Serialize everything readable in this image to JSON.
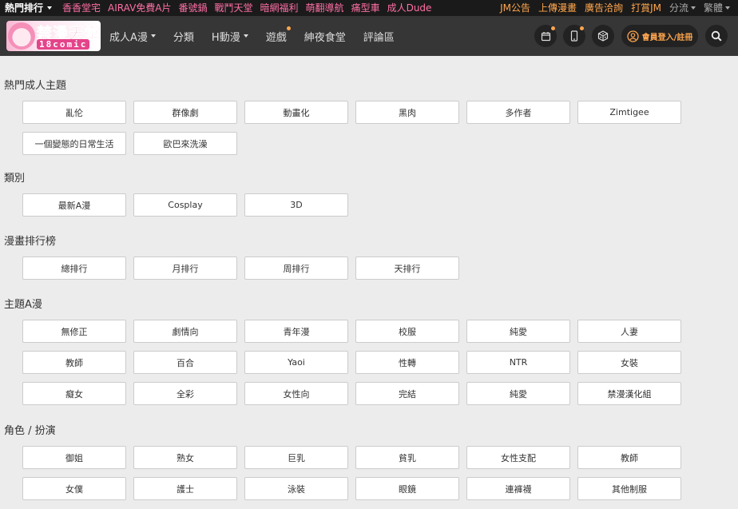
{
  "topbar": {
    "rank_label": "熱門排行",
    "links": [
      "香香堂宅",
      "AIRAV免費A片",
      "番號鍋",
      "戰鬥天堂",
      "暗網福利",
      "萌翻導航",
      "痛型車",
      "成人Dude"
    ],
    "right_orange": [
      "JM公告",
      "上傳漫畫",
      "廣告洽詢",
      "打賞JM"
    ],
    "split_label": "分流",
    "lang_label": "繁體"
  },
  "header": {
    "logo_title": "禁漫天堂",
    "logo_sub": "18comic",
    "nav": [
      {
        "label": "成人A漫",
        "dropdown": true
      },
      {
        "label": "分類",
        "dropdown": false
      },
      {
        "label": "H動漫",
        "dropdown": true
      },
      {
        "label": "遊戲",
        "dropdown": false
      },
      {
        "label": "紳夜食堂",
        "dropdown": false
      },
      {
        "label": "評論區",
        "dropdown": false
      }
    ],
    "login_label": "會員登入/註冊"
  },
  "sections": [
    {
      "title": "熱門成人主題",
      "tags": [
        "亂伦",
        "群像劇",
        "動畫化",
        "黑肉",
        "多作者",
        "Zimtigee",
        "一個變態的日常生活",
        "歐巴來洗澡"
      ]
    },
    {
      "title": "類別",
      "tags": [
        "最新A漫",
        "Cosplay",
        "3D"
      ]
    },
    {
      "title": "漫畫排行榜",
      "tags": [
        "總排行",
        "月排行",
        "周排行",
        "天排行"
      ]
    },
    {
      "title": "主題A漫",
      "tags": [
        "無修正",
        "劇情向",
        "青年漫",
        "校服",
        "純愛",
        "人妻",
        "教師",
        "百合",
        "Yaoi",
        "性轉",
        "NTR",
        "女裝",
        "癡女",
        "全彩",
        "女性向",
        "完結",
        "純愛",
        "禁漫漢化組"
      ]
    },
    {
      "title": "角色 / 扮演",
      "tags": [
        "御姐",
        "熟女",
        "巨乳",
        "貧乳",
        "女性支配",
        "教師",
        "女僕",
        "護士",
        "泳裝",
        "眼鏡",
        "連褲襪",
        "其他制服"
      ]
    }
  ],
  "colors": {
    "topbar_bg": "#1a1a1a",
    "header_bg": "#363636",
    "pink_link": "#ff6fa5",
    "orange": "#ffa64d",
    "page_bg": "#ececec"
  }
}
